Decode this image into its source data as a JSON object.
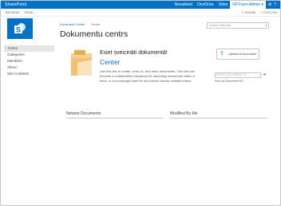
{
  "suitebar": {
    "brand": "SharePoint",
    "links": [
      "Newsfeed",
      "OneDrive",
      "Sites"
    ],
    "user": "SP Farm Admin ▾",
    "settings_icon": "gear-icon",
    "help_icon": "?"
  },
  "ribbon": {
    "tabs": [
      "BROWSE",
      "PAGE"
    ],
    "actions": [
      "SHARE",
      "FOLLOW"
    ]
  },
  "breadcrumb": {
    "site": "Document Center",
    "current": "Home"
  },
  "page_title": "Dokumentu centrs",
  "search": {
    "placeholder": "Search this site"
  },
  "leftnav": {
    "items": [
      "Home",
      "Categories",
      "Members",
      "About",
      "Site Contents"
    ]
  },
  "welcome": {
    "heading": "Esiet sveicināti dokumentā!",
    "subheading": "Center",
    "description": "Use this site to create, work on, and store documents. This site can become a collaborative repository for authoring documents within a team, or a knowledge base for documents across multiple teams."
  },
  "upload": {
    "label": "Upload a Document"
  },
  "find_by_id": {
    "placeholder": "ENTER DOCUMENT ID →",
    "label": "Find by Document ID"
  },
  "webparts": {
    "newest": "Newest Documents",
    "modified": "Modified By Me"
  },
  "colors": {
    "accent": "#0072c6",
    "hero_orange": "#f4c06b"
  }
}
